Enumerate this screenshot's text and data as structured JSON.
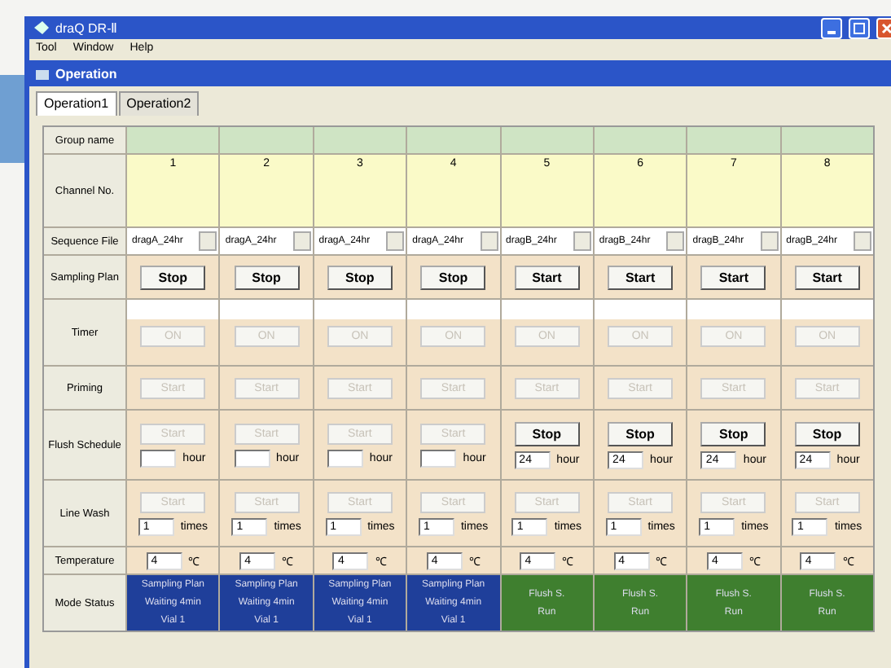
{
  "window": {
    "title": "draQ DR-Ⅱ"
  },
  "menu": [
    "Tool",
    "Window",
    "Help"
  ],
  "child_window": {
    "title": "Operation"
  },
  "tabs": [
    {
      "label": "Operation1",
      "selected": true
    },
    {
      "label": "Operation2",
      "selected": false
    }
  ],
  "row_labels": [
    "Group name",
    "Channel No.",
    "Sequence File",
    "Sampling Plan",
    "Timer",
    "Priming",
    "Flush Schedule",
    "Line Wash",
    "Temperature",
    "Mode Status"
  ],
  "channels": [
    {
      "number": "1",
      "sequence_file": "dragA_24hr",
      "sampling": {
        "label": "Stop",
        "disabled": false
      },
      "timer": {
        "label": "ON",
        "disabled": true
      },
      "priming": {
        "label": "Start",
        "disabled": true
      },
      "flush": {
        "label": "Start",
        "disabled": true,
        "unit": "hour"
      },
      "wash": {
        "label": "Start",
        "disabled": true,
        "value": "1",
        "unit": "times"
      },
      "temperature": {
        "value": "4",
        "unit": "℃"
      },
      "status": {
        "lines": [
          "Sampling Plan",
          "Waiting 4min",
          "Vial 1"
        ],
        "color": "#1f3f9a"
      }
    },
    {
      "number": "2",
      "sequence_file": "dragA_24hr",
      "sampling": {
        "label": "Stop",
        "disabled": false
      },
      "timer": {
        "label": "ON",
        "disabled": true
      },
      "priming": {
        "label": "Start",
        "disabled": true
      },
      "flush": {
        "label": "Start",
        "disabled": true,
        "unit": "hour"
      },
      "wash": {
        "label": "Start",
        "disabled": true,
        "value": "1",
        "unit": "times"
      },
      "temperature": {
        "value": "4",
        "unit": "℃"
      },
      "status": {
        "lines": [
          "Sampling Plan",
          "Waiting 4min",
          "Vial 1"
        ],
        "color": "#1f3f9a"
      }
    },
    {
      "number": "3",
      "sequence_file": "dragA_24hr",
      "sampling": {
        "label": "Stop",
        "disabled": false
      },
      "timer": {
        "label": "ON",
        "disabled": true
      },
      "priming": {
        "label": "Start",
        "disabled": true
      },
      "flush": {
        "label": "Start",
        "disabled": true,
        "unit": "hour"
      },
      "wash": {
        "label": "Start",
        "disabled": true,
        "value": "1",
        "unit": "times"
      },
      "temperature": {
        "value": "4",
        "unit": "℃"
      },
      "status": {
        "lines": [
          "Sampling Plan",
          "Waiting 4min",
          "Vial 1"
        ],
        "color": "#1f3f9a"
      }
    },
    {
      "number": "4",
      "sequence_file": "dragA_24hr",
      "sampling": {
        "label": "Stop",
        "disabled": false
      },
      "timer": {
        "label": "ON",
        "disabled": true
      },
      "priming": {
        "label": "Start",
        "disabled": true
      },
      "flush": {
        "label": "Start",
        "disabled": true,
        "unit": "hour"
      },
      "wash": {
        "label": "Start",
        "disabled": true,
        "value": "1",
        "unit": "times"
      },
      "temperature": {
        "value": "4",
        "unit": "℃"
      },
      "status": {
        "lines": [
          "Sampling Plan",
          "Waiting 4min",
          "Vial 1"
        ],
        "color": "#1f3f9a"
      }
    },
    {
      "number": "5",
      "sequence_file": "dragB_24hr",
      "sampling": {
        "label": "Start",
        "disabled": false
      },
      "timer": {
        "label": "ON",
        "disabled": true
      },
      "priming": {
        "label": "Start",
        "disabled": true
      },
      "flush": {
        "label": "Stop",
        "disabled": false,
        "value": "24",
        "unit": "hour"
      },
      "wash": {
        "label": "Start",
        "disabled": true,
        "value": "1",
        "unit": "times"
      },
      "temperature": {
        "value": "4",
        "unit": "℃"
      },
      "status": {
        "lines": [
          "Flush S.",
          "Run"
        ],
        "color": "#3f7f2f"
      }
    },
    {
      "number": "6",
      "sequence_file": "dragB_24hr",
      "sampling": {
        "label": "Start",
        "disabled": false
      },
      "timer": {
        "label": "ON",
        "disabled": true
      },
      "priming": {
        "label": "Start",
        "disabled": true
      },
      "flush": {
        "label": "Stop",
        "disabled": false,
        "value": "24",
        "unit": "hour"
      },
      "wash": {
        "label": "Start",
        "disabled": true,
        "value": "1",
        "unit": "times"
      },
      "temperature": {
        "value": "4",
        "unit": "℃"
      },
      "status": {
        "lines": [
          "Flush S.",
          "Run"
        ],
        "color": "#3f7f2f"
      }
    },
    {
      "number": "7",
      "sequence_file": "dragB_24hr",
      "sampling": {
        "label": "Start",
        "disabled": false
      },
      "timer": {
        "label": "ON",
        "disabled": true
      },
      "priming": {
        "label": "Start",
        "disabled": true
      },
      "flush": {
        "label": "Stop",
        "disabled": false,
        "value": "24",
        "unit": "hour"
      },
      "wash": {
        "label": "Start",
        "disabled": true,
        "value": "1",
        "unit": "times"
      },
      "temperature": {
        "value": "4",
        "unit": "℃"
      },
      "status": {
        "lines": [
          "Flush S.",
          "Run"
        ],
        "color": "#3f7f2f"
      }
    },
    {
      "number": "8",
      "sequence_file": "dragB_24hr",
      "sampling": {
        "label": "Start",
        "disabled": false
      },
      "timer": {
        "label": "ON",
        "disabled": true
      },
      "priming": {
        "label": "Start",
        "disabled": true
      },
      "flush": {
        "label": "Stop",
        "disabled": false,
        "value": "24",
        "unit": "hour"
      },
      "wash": {
        "label": "Start",
        "disabled": true,
        "value": "1",
        "unit": "times"
      },
      "temperature": {
        "value": "4",
        "unit": "℃"
      },
      "status": {
        "lines": [
          "Flush S.",
          "Run"
        ],
        "color": "#3f7f2f"
      }
    }
  ]
}
